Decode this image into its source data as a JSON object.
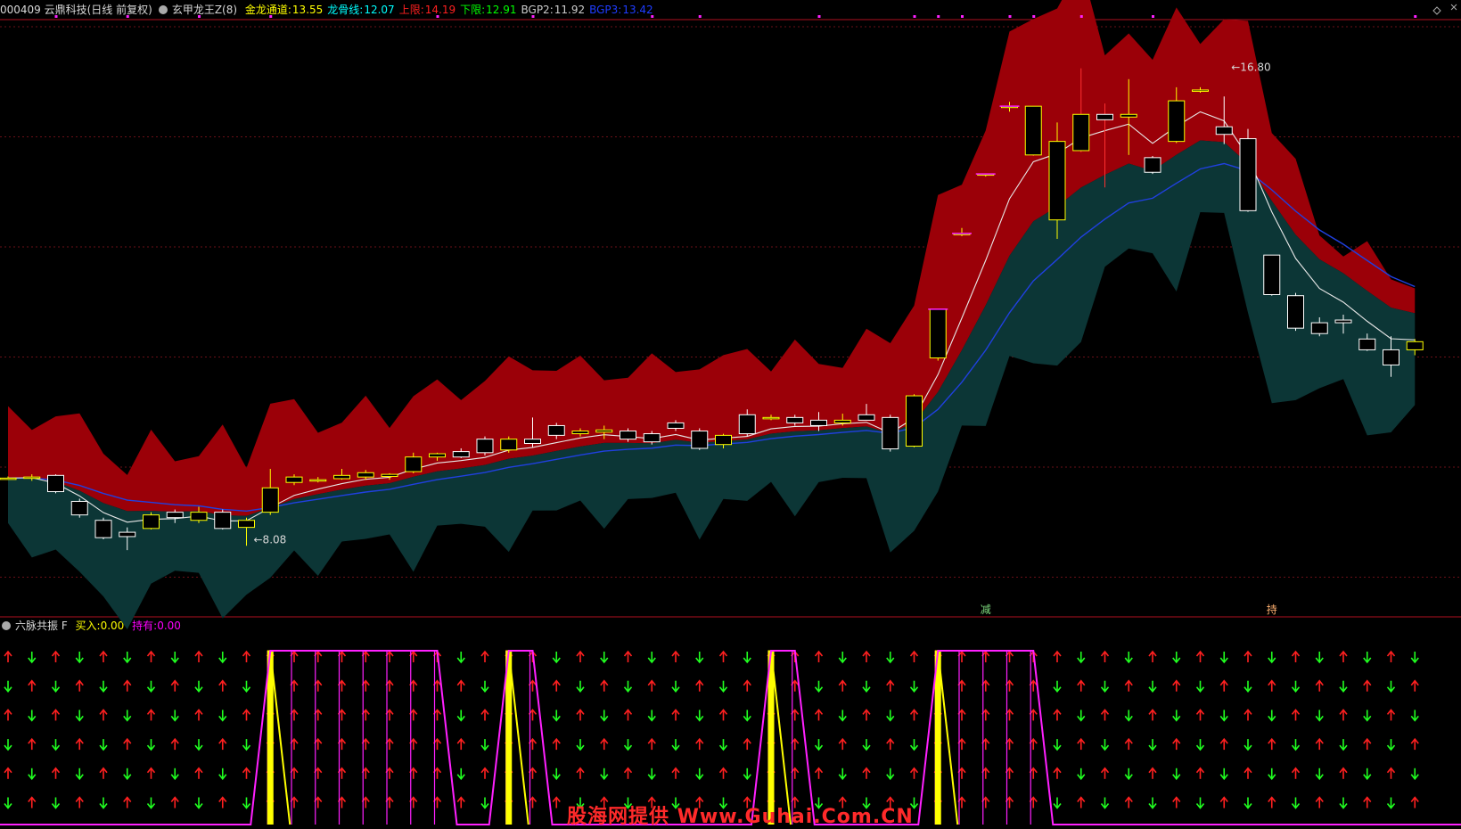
{
  "header": {
    "stock": "000409 云鼎科技(日线 前复权)",
    "indicator": "玄甲龙王Z(8)",
    "items": [
      {
        "label": "金龙通道:",
        "value": "13.55",
        "color": "#ffff00"
      },
      {
        "label": "龙骨线:",
        "value": "12.07",
        "color": "#00ffff"
      },
      {
        "label": "上限:",
        "value": "14.19",
        "color": "#ff2020"
      },
      {
        "label": "下限:",
        "value": "12.91",
        "color": "#00ff00"
      },
      {
        "label": "BGP2:",
        "value": "11.92",
        "color": "#cccccc"
      },
      {
        "label": "BGP3:",
        "value": "13.42",
        "color": "#1e3cff"
      }
    ]
  },
  "sub_header": {
    "title": "六脉共振 F",
    "buy_label": "买入:",
    "buy_value": "0.00",
    "hold_label": "持有:",
    "hold_value": "0.00"
  },
  "watermark": "股海网提供 Www.Guhai.Com.CN",
  "chart_data": [
    {
      "type": "candlestick",
      "ylim": [
        6.8,
        17.8
      ],
      "annotations": [
        {
          "text": "16.80",
          "x": 51,
          "y": 16.8
        },
        {
          "text": "8.08",
          "x": 10,
          "y": 8.08
        }
      ],
      "signal_labels": [
        {
          "text": "减",
          "x": 41
        },
        {
          "text": "持",
          "x": 53
        }
      ],
      "candles": [
        [
          9.33,
          9.33,
          9.36,
          9.3
        ],
        [
          9.33,
          9.35,
          9.4,
          9.28
        ],
        [
          9.38,
          9.08,
          9.4,
          9.05
        ],
        [
          8.9,
          8.65,
          8.95,
          8.6
        ],
        [
          8.55,
          8.23,
          8.6,
          8.2
        ],
        [
          8.33,
          8.25,
          8.42,
          8.0
        ],
        [
          8.4,
          8.65,
          8.7,
          8.38
        ],
        [
          8.7,
          8.6,
          8.75,
          8.5
        ],
        [
          8.55,
          8.7,
          8.8,
          8.5
        ],
        [
          8.7,
          8.4,
          8.75,
          8.38
        ],
        [
          8.42,
          8.55,
          8.6,
          8.08
        ],
        [
          8.7,
          9.15,
          9.5,
          8.65
        ],
        [
          9.25,
          9.35,
          9.4,
          9.2
        ],
        [
          9.28,
          9.3,
          9.35,
          9.25
        ],
        [
          9.32,
          9.38,
          9.5,
          9.3
        ],
        [
          9.35,
          9.43,
          9.48,
          9.3
        ],
        [
          9.36,
          9.4,
          9.42,
          9.3
        ],
        [
          9.45,
          9.72,
          9.8,
          9.42
        ],
        [
          9.72,
          9.78,
          9.8,
          9.65
        ],
        [
          9.82,
          9.72,
          9.88,
          9.7
        ],
        [
          10.05,
          9.8,
          10.1,
          9.75
        ],
        [
          9.85,
          10.05,
          10.1,
          9.8
        ],
        [
          10.05,
          9.97,
          10.45,
          9.9
        ],
        [
          10.3,
          10.12,
          10.35,
          10.05
        ],
        [
          10.15,
          10.2,
          10.25,
          10.1
        ],
        [
          10.18,
          10.22,
          10.3,
          10.05
        ],
        [
          10.2,
          10.05,
          10.25,
          10.0
        ],
        [
          10.15,
          10.0,
          10.2,
          9.95
        ],
        [
          10.35,
          10.25,
          10.4,
          10.2
        ],
        [
          10.2,
          9.88,
          10.25,
          9.85
        ],
        [
          9.95,
          10.12,
          10.15,
          9.88
        ],
        [
          10.5,
          10.15,
          10.6,
          10.1
        ],
        [
          10.45,
          10.45,
          10.5,
          10.4
        ],
        [
          10.45,
          10.35,
          10.5,
          10.3
        ],
        [
          10.4,
          10.3,
          10.55,
          10.2
        ],
        [
          10.35,
          10.4,
          10.52,
          10.3
        ],
        [
          10.5,
          10.4,
          10.7,
          10.4
        ],
        [
          10.45,
          9.87,
          10.5,
          9.82
        ],
        [
          9.92,
          10.85,
          10.88,
          9.9
        ],
        [
          11.55,
          12.45,
          12.45,
          11.5
        ],
        [
          13.85,
          13.85,
          13.95,
          13.8
        ],
        [
          14.95,
          14.95,
          14.95,
          14.9
        ],
        [
          16.2,
          16.2,
          16.28,
          16.1
        ],
        [
          15.3,
          16.2,
          16.2,
          15.28
        ],
        [
          14.1,
          15.55,
          15.9,
          13.75
        ],
        [
          15.38,
          16.05,
          16.9,
          15.35
        ],
        [
          16.05,
          15.95,
          16.25,
          14.7
        ],
        [
          16.0,
          16.05,
          16.7,
          15.3
        ],
        [
          15.25,
          14.98,
          15.28,
          14.95
        ],
        [
          15.55,
          16.3,
          16.55,
          15.52
        ],
        [
          16.5,
          16.5,
          16.55,
          16.45
        ],
        [
          15.82,
          15.68,
          16.38,
          15.5
        ],
        [
          15.6,
          14.27,
          15.78,
          14.25
        ],
        [
          13.45,
          12.72,
          13.45,
          12.7
        ],
        [
          12.7,
          12.1,
          12.75,
          12.05
        ],
        [
          12.2,
          12.0,
          12.3,
          11.95
        ],
        [
          12.25,
          12.2,
          12.35,
          12.0
        ],
        [
          11.9,
          11.7,
          12.0,
          11.68
        ],
        [
          11.7,
          11.42,
          11.95,
          11.2
        ],
        [
          11.7,
          11.85,
          11.9,
          11.6
        ]
      ]
    },
    {
      "type": "signal_grid",
      "rows": 6,
      "step_up": [
        [
          11,
          18
        ],
        [
          21,
          22
        ],
        [
          32,
          33
        ],
        [
          39,
          43
        ]
      ]
    }
  ]
}
